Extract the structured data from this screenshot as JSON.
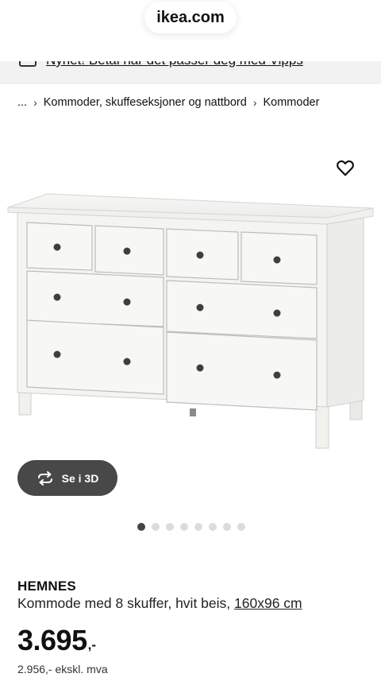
{
  "browser": {
    "url": "ikea.com"
  },
  "promo": {
    "text": "Nyhet! Betal når det passer deg med Vipps",
    "icon": "card-icon"
  },
  "breadcrumb": {
    "ellipsis": "...",
    "items": [
      "Kommoder, skuffeseksjoner og nattbord",
      "Kommoder"
    ]
  },
  "gallery": {
    "favorite_icon": "heart-icon",
    "view_3d_label": "Se i 3D",
    "view_3d_icon": "rotate-icon",
    "dot_count": 8,
    "active_dot": 0
  },
  "product": {
    "brand": "HEMNES",
    "description": "Kommode med 8 skuffer, hvit beis,",
    "size_link": "160x96 cm",
    "price": "3.695",
    "price_suffix": ",-",
    "price_ex_vat": "2.956,- ekskl. mva"
  },
  "colors": {
    "button_dark": "#484848",
    "dot_active": "#444444",
    "dot_inactive": "#dcdcdc",
    "promo_bg": "#f2f2f2"
  }
}
